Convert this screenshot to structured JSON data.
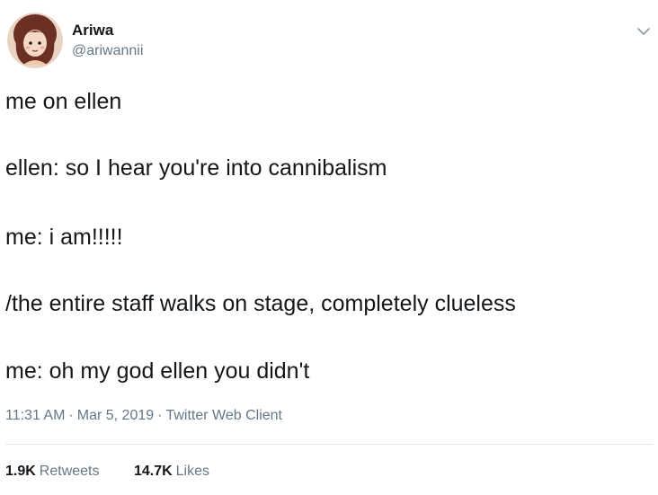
{
  "author": {
    "display_name": "Ariwa",
    "handle": "@ariwannii",
    "avatar_icon": "cartoon-avatar-icon"
  },
  "tweet": {
    "lines": [
      "me on ellen",
      "ellen: so I hear you're into cannibalism",
      "me: i am!!!!!",
      "/the entire staff walks on stage, completely clueless",
      "me: oh my god ellen you didn't"
    ]
  },
  "meta": {
    "time": "11:31 AM",
    "date": "Mar 5, 2019",
    "source": "Twitter Web Client",
    "separator": "·"
  },
  "stats": {
    "retweets_count": "1.9K",
    "retweets_label": "Retweets",
    "likes_count": "14.7K",
    "likes_label": "Likes"
  },
  "colors": {
    "primary_text": "#14171a",
    "secondary_text": "#657786",
    "divider": "#e1e8ed"
  },
  "icons": {
    "menu": "chevron-down-icon"
  }
}
